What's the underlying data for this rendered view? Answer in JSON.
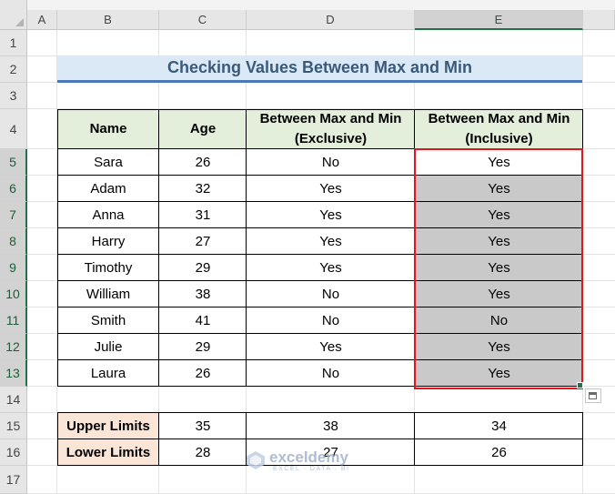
{
  "columns": [
    "A",
    "B",
    "C",
    "D",
    "E"
  ],
  "rows": [
    "1",
    "2",
    "3",
    "4",
    "5",
    "6",
    "7",
    "8",
    "9",
    "10",
    "11",
    "12",
    "13",
    "14",
    "15",
    "16",
    "17"
  ],
  "title": "Checking Values Between Max and Min",
  "table": {
    "headers": {
      "name": "Name",
      "age": "Age",
      "exclusive_1": "Between Max and Min",
      "exclusive_2": "(Exclusive)",
      "inclusive_1": "Between Max and Min",
      "inclusive_2": "(Inclusive)"
    },
    "rows": [
      {
        "name": "Sara",
        "age": "26",
        "exclusive": "No",
        "inclusive": "Yes"
      },
      {
        "name": "Adam",
        "age": "32",
        "exclusive": "Yes",
        "inclusive": "Yes"
      },
      {
        "name": "Anna",
        "age": "31",
        "exclusive": "Yes",
        "inclusive": "Yes"
      },
      {
        "name": "Harry",
        "age": "27",
        "exclusive": "Yes",
        "inclusive": "Yes"
      },
      {
        "name": "Timothy",
        "age": "29",
        "exclusive": "Yes",
        "inclusive": "Yes"
      },
      {
        "name": "William",
        "age": "38",
        "exclusive": "No",
        "inclusive": "Yes"
      },
      {
        "name": "Smith",
        "age": "41",
        "exclusive": "No",
        "inclusive": "No"
      },
      {
        "name": "Julie",
        "age": "29",
        "exclusive": "Yes",
        "inclusive": "Yes"
      },
      {
        "name": "Laura",
        "age": "26",
        "exclusive": "No",
        "inclusive": "Yes"
      }
    ]
  },
  "limits": {
    "upper": {
      "label": "Upper Limits",
      "age": "35",
      "exclusive": "38",
      "inclusive": "34"
    },
    "lower": {
      "label": "Lower Limits",
      "age": "28",
      "exclusive": "27",
      "inclusive": "26"
    }
  },
  "watermark": {
    "name": "exceldemy",
    "tagline": "EXCEL · DATA · BI"
  },
  "colors": {
    "header_fill": "#e3efdb",
    "title_fill": "#dbe9f6",
    "title_underline": "#4a78b6",
    "selection_fill": "#c9c9c9",
    "selection_border": "#e3151a",
    "limit_fill": "#fbe5d6",
    "excel_green": "#217346"
  }
}
